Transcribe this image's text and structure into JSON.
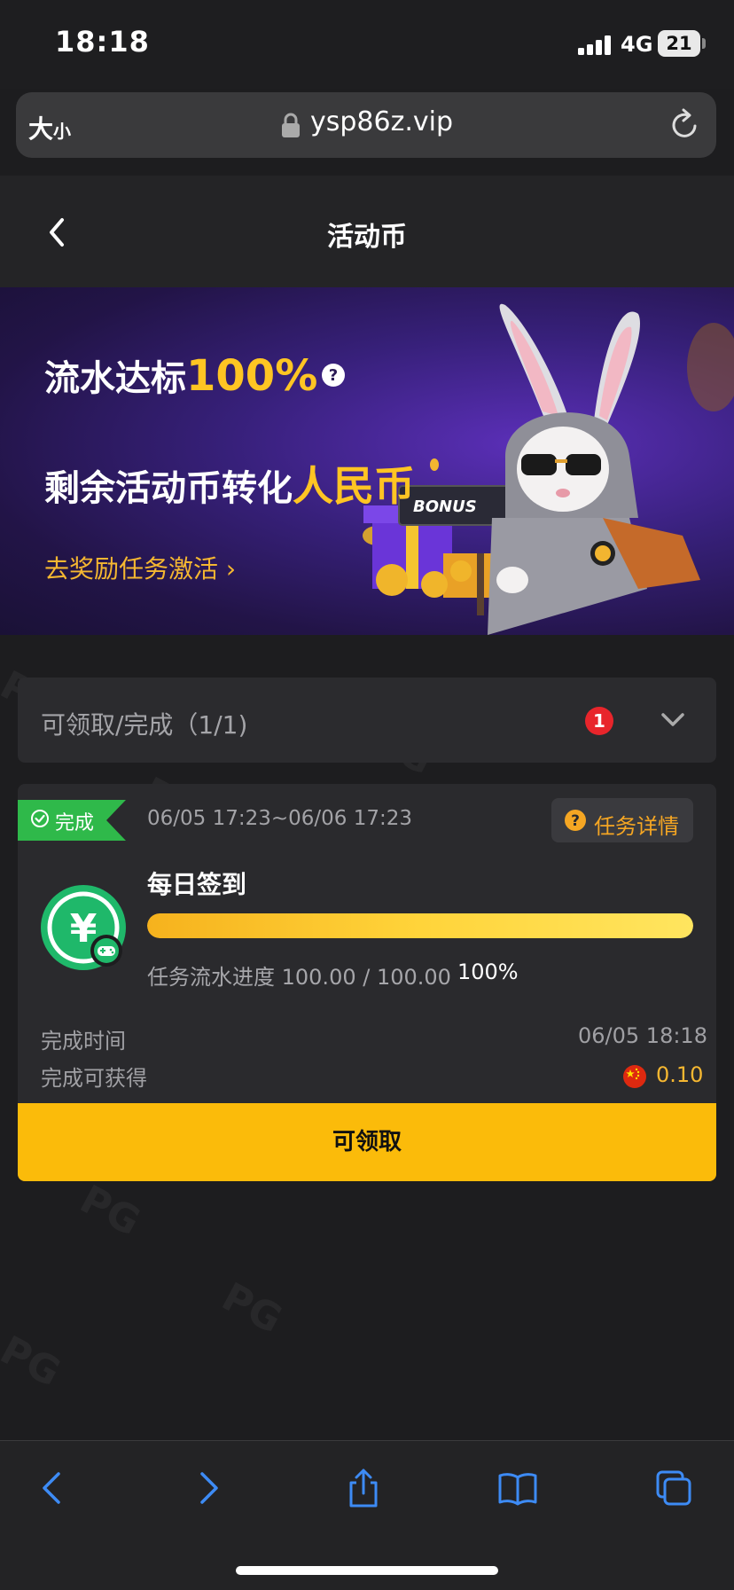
{
  "status_bar": {
    "time": "18:18",
    "network": "4G",
    "battery": "21"
  },
  "browser": {
    "text_size_big": "大",
    "text_size_small": "小",
    "url": "ysp86z.vip"
  },
  "header": {
    "title": "活动币"
  },
  "banner": {
    "line1_prefix": "流水达标",
    "line1_highlight": "100%",
    "line2_prefix": "剩余活动币转化",
    "line2_highlight": "人民币",
    "link_label": "去奖励任务激活 ",
    "sign_text": "BONUS"
  },
  "dropdown": {
    "label": "可领取/完成（1/1)",
    "badge": "1"
  },
  "task": {
    "status_tag": "完成",
    "date_range": "06/05 17:23~06/06 17:23",
    "detail_label": "任务详情",
    "name": "每日签到",
    "progress_text": "任务流水进度 100.00 / 100.00",
    "progress_percent_text": "100%",
    "progress_fraction": 1.0,
    "complete_time_label": "完成时间",
    "complete_time_value": "06/05 18:18",
    "reward_label": "完成可获得",
    "reward_value": "0.10",
    "claim_label": "可领取"
  },
  "colors": {
    "accent": "#fbbb0a",
    "success": "#2fb94a",
    "highlight": "#ffc523",
    "badge": "#e8252b"
  },
  "icons": [
    "back-icon",
    "help-icon",
    "chevron-down-icon",
    "check-circle-icon",
    "question-icon",
    "yuan-icon",
    "gamepad-icon",
    "china-flag-icon",
    "lock-icon",
    "reload-icon",
    "nav-back-icon",
    "nav-forward-icon",
    "share-icon",
    "bookmarks-icon",
    "tabs-icon"
  ]
}
